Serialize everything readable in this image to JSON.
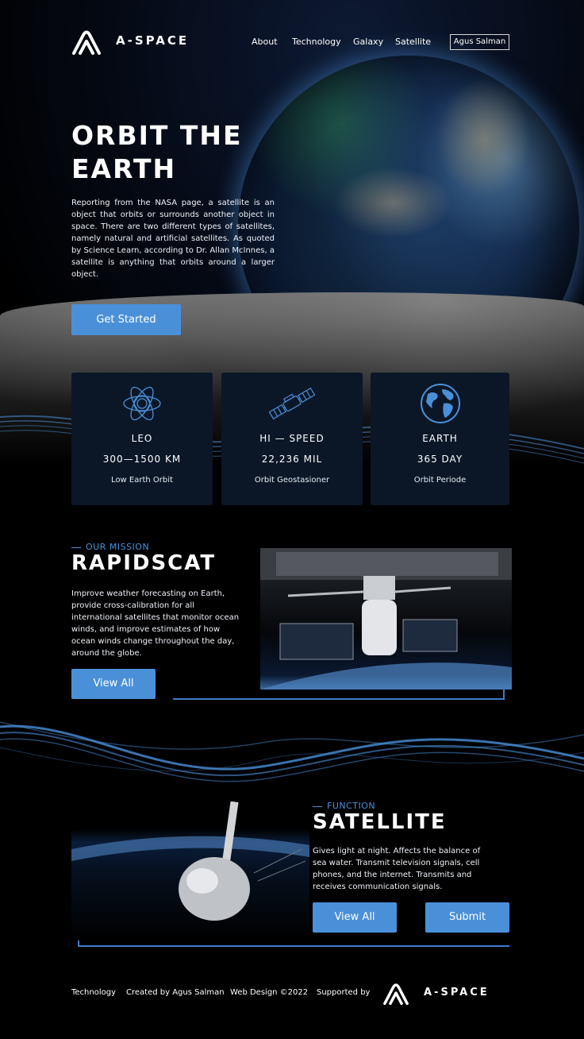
{
  "brand": {
    "name": "A-SPACE",
    "logo_icon": "a-space-logo-icon"
  },
  "nav": {
    "links": [
      "About",
      "Technology",
      "Galaxy",
      "Satellite"
    ],
    "user": "Agus Salman"
  },
  "hero": {
    "title": "ORBIT THE EARTH",
    "description": "Reporting from the NASA page, a satellite is an object that orbits or surrounds another object in space.  There are two different types of satellites, namely natural and artificial satellites.  As quoted by Science Learn, according to Dr. Allan McInnes, a satellite is anything that orbits around a larger object.",
    "cta": "Get Started"
  },
  "stats": [
    {
      "icon": "atom-orbit-icon",
      "label": "LEO",
      "value": "300—1500 KM",
      "sub": "Low Earth Orbit"
    },
    {
      "icon": "satellite-icon",
      "label": "HI — SPEED",
      "value": "22,236 MIL",
      "sub": "Orbit Geostasioner"
    },
    {
      "icon": "earth-globe-icon",
      "label": "EARTH",
      "value": "365 DAY",
      "sub": "Orbit Periode"
    }
  ],
  "mission": {
    "eyebrow": "OUR MISSION",
    "title": "RAPIDSCAT",
    "description": "Improve weather forecasting on Earth, provide cross-calibration for all international satellites that monitor ocean winds, and improve estimates of how ocean winds change throughout the day, around the globe.",
    "button": "View All"
  },
  "function": {
    "eyebrow": "FUNCTION",
    "title": "SATELLITE",
    "description": "Gives light at night.  Affects the balance of sea water.  Transmit television signals, cell phones, and the internet.  Transmits and receives communication signals.",
    "button_view": "View All",
    "button_submit": "Submit"
  },
  "footer": {
    "items": [
      "Technology",
      "Created by Agus Salman",
      "Web Design ©2022",
      "Supported by"
    ],
    "brand": "A-SPACE"
  },
  "colors": {
    "accent": "#4a90d9",
    "card_bg": "#0b1727",
    "frame": "#3d7cc9"
  }
}
